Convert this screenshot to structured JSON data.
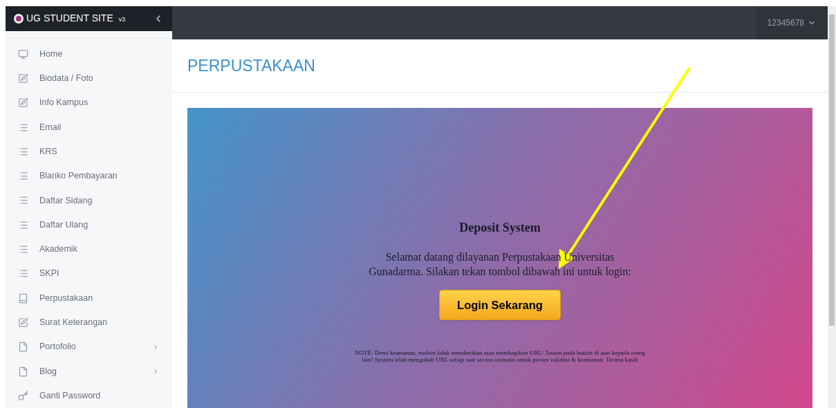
{
  "brand": {
    "title": "UG STUDENT SITE",
    "version": "v3"
  },
  "user": {
    "id": "12345678"
  },
  "sidebar": {
    "items": [
      {
        "label": "Home",
        "kind": "monitor",
        "submenu": false
      },
      {
        "label": "Biodata / Foto",
        "kind": "edit",
        "submenu": false
      },
      {
        "label": "Info Kampus",
        "kind": "edit",
        "submenu": false
      },
      {
        "label": "Email",
        "kind": "list",
        "submenu": false
      },
      {
        "label": "KRS",
        "kind": "list",
        "submenu": false
      },
      {
        "label": "Blanko Pembayaran",
        "kind": "list",
        "submenu": false
      },
      {
        "label": "Daftar Sidang",
        "kind": "list",
        "submenu": false
      },
      {
        "label": "Daftar Ulang",
        "kind": "list",
        "submenu": false
      },
      {
        "label": "Akademik",
        "kind": "list",
        "submenu": false
      },
      {
        "label": "SKPI",
        "kind": "list",
        "submenu": false
      },
      {
        "label": "Perpustakaan",
        "kind": "book",
        "submenu": false
      },
      {
        "label": "Surat Keterangan",
        "kind": "edit",
        "submenu": false
      },
      {
        "label": "Portofolio",
        "kind": "file",
        "submenu": true
      },
      {
        "label": "Blog",
        "kind": "file",
        "submenu": true
      },
      {
        "label": "Ganti Password",
        "kind": "key",
        "submenu": false
      }
    ]
  },
  "page": {
    "title": "PERPUSTAKAAN"
  },
  "panel": {
    "heading": "Deposit System",
    "message": "Selamat datang dilayanan Perpustakaan Universitas Gunadarma. Silakan tekan tombol dibawah ini untuk login:",
    "button": "Login Sekarang",
    "note": "NOTE: Demi keamanan, mohon tidak memberikan atau membagikan URL/ Tautan pada button di atas kepada orang lain! System telah mengubah URL setiap saat secara otomatis untuk proses validasi & keamanan. Terima kasih"
  }
}
